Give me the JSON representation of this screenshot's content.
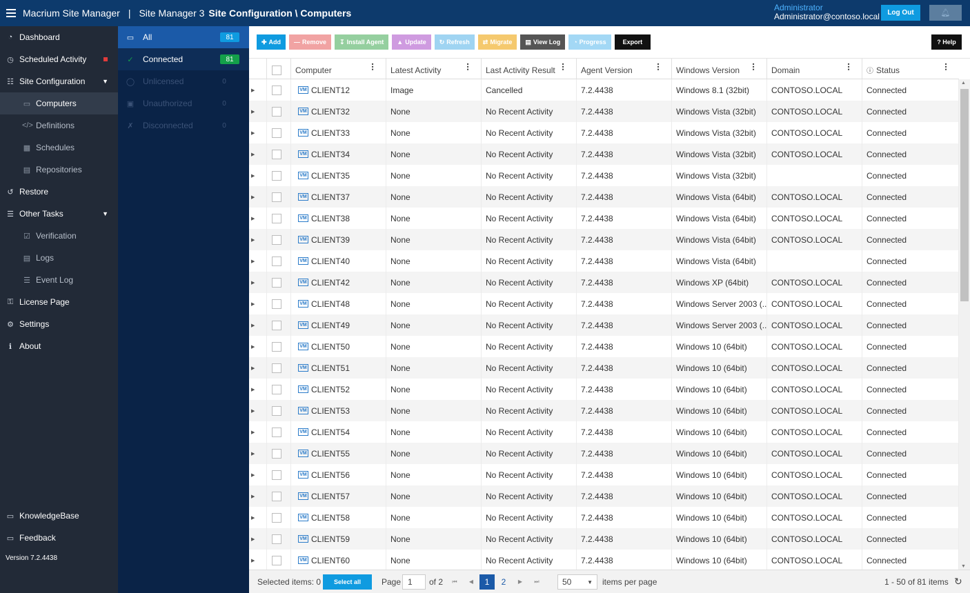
{
  "header": {
    "app_title": "Macrium Site Manager",
    "site": "Site Manager 3",
    "breadcrumb": "Site Configuration \\ Computers",
    "user_role": "Administrator",
    "user_email": "Administrator@contoso.local",
    "logout_label": "Log Out"
  },
  "sidebar": {
    "items": [
      {
        "label": "Dashboard",
        "icon": "dashboard-icon"
      },
      {
        "label": "Scheduled Activity",
        "icon": "clock-icon"
      },
      {
        "label": "Site Configuration",
        "icon": "sitemap-icon"
      },
      {
        "label": "Computers",
        "icon": "monitor-icon"
      },
      {
        "label": "Definitions",
        "icon": "code-icon"
      },
      {
        "label": "Schedules",
        "icon": "calendar-icon"
      },
      {
        "label": "Repositories",
        "icon": "database-icon"
      },
      {
        "label": "Restore",
        "icon": "restore-icon"
      },
      {
        "label": "Other Tasks",
        "icon": "tasks-icon"
      },
      {
        "label": "Verification",
        "icon": "check-square-icon"
      },
      {
        "label": "Logs",
        "icon": "file-icon"
      },
      {
        "label": "Event Log",
        "icon": "list-icon"
      },
      {
        "label": "License Page",
        "icon": "key-icon"
      },
      {
        "label": "Settings",
        "icon": "gear-icon"
      },
      {
        "label": "About",
        "icon": "info-icon"
      }
    ],
    "knowledgebase": "KnowledgeBase",
    "feedback": "Feedback",
    "version": "Version 7.2.4438"
  },
  "filters": [
    {
      "label": "All",
      "count": "81"
    },
    {
      "label": "Connected",
      "count": "81"
    },
    {
      "label": "Unlicensed",
      "count": "0"
    },
    {
      "label": "Unauthorized",
      "count": "0"
    },
    {
      "label": "Disconnected",
      "count": "0"
    }
  ],
  "toolbar": {
    "add": "Add",
    "remove": "Remove",
    "install_agent": "Install Agent",
    "update": "Update",
    "refresh": "Refresh",
    "migrate": "Migrate",
    "view_log": "View Log",
    "progress": "Progress",
    "export": "Export",
    "help": "Help"
  },
  "colors": {
    "topbar": "#0d3a6c",
    "sidebar": "#222a37",
    "filter_panel": "#0a2347",
    "accent": "#0f9be0",
    "connected_badge": "#14a04a"
  },
  "grid": {
    "columns": [
      "Computer",
      "Latest Activity",
      "Last Activity Result",
      "Agent Version",
      "Windows Version",
      "Domain",
      "Status"
    ],
    "rows": [
      [
        "CLIENT12",
        "Image",
        "Cancelled",
        "7.2.4438",
        "Windows 8.1 (32bit)",
        "CONTOSO.LOCAL",
        "Connected"
      ],
      [
        "CLIENT32",
        "None",
        "No Recent Activity",
        "7.2.4438",
        "Windows Vista (32bit)",
        "CONTOSO.LOCAL",
        "Connected"
      ],
      [
        "CLIENT33",
        "None",
        "No Recent Activity",
        "7.2.4438",
        "Windows Vista (32bit)",
        "CONTOSO.LOCAL",
        "Connected"
      ],
      [
        "CLIENT34",
        "None",
        "No Recent Activity",
        "7.2.4438",
        "Windows Vista (32bit)",
        "CONTOSO.LOCAL",
        "Connected"
      ],
      [
        "CLIENT35",
        "None",
        "No Recent Activity",
        "7.2.4438",
        "Windows Vista (32bit)",
        "",
        "Connected"
      ],
      [
        "CLIENT37",
        "None",
        "No Recent Activity",
        "7.2.4438",
        "Windows Vista (64bit)",
        "CONTOSO.LOCAL",
        "Connected"
      ],
      [
        "CLIENT38",
        "None",
        "No Recent Activity",
        "7.2.4438",
        "Windows Vista (64bit)",
        "CONTOSO.LOCAL",
        "Connected"
      ],
      [
        "CLIENT39",
        "None",
        "No Recent Activity",
        "7.2.4438",
        "Windows Vista (64bit)",
        "CONTOSO.LOCAL",
        "Connected"
      ],
      [
        "CLIENT40",
        "None",
        "No Recent Activity",
        "7.2.4438",
        "Windows Vista (64bit)",
        "",
        "Connected"
      ],
      [
        "CLIENT42",
        "None",
        "No Recent Activity",
        "7.2.4438",
        "Windows XP (64bit)",
        "CONTOSO.LOCAL",
        "Connected"
      ],
      [
        "CLIENT48",
        "None",
        "No Recent Activity",
        "7.2.4438",
        "Windows Server 2003 (...",
        "CONTOSO.LOCAL",
        "Connected"
      ],
      [
        "CLIENT49",
        "None",
        "No Recent Activity",
        "7.2.4438",
        "Windows Server 2003 (...",
        "CONTOSO.LOCAL",
        "Connected"
      ],
      [
        "CLIENT50",
        "None",
        "No Recent Activity",
        "7.2.4438",
        "Windows 10 (64bit)",
        "CONTOSO.LOCAL",
        "Connected"
      ],
      [
        "CLIENT51",
        "None",
        "No Recent Activity",
        "7.2.4438",
        "Windows 10 (64bit)",
        "CONTOSO.LOCAL",
        "Connected"
      ],
      [
        "CLIENT52",
        "None",
        "No Recent Activity",
        "7.2.4438",
        "Windows 10 (64bit)",
        "CONTOSO.LOCAL",
        "Connected"
      ],
      [
        "CLIENT53",
        "None",
        "No Recent Activity",
        "7.2.4438",
        "Windows 10 (64bit)",
        "CONTOSO.LOCAL",
        "Connected"
      ],
      [
        "CLIENT54",
        "None",
        "No Recent Activity",
        "7.2.4438",
        "Windows 10 (64bit)",
        "CONTOSO.LOCAL",
        "Connected"
      ],
      [
        "CLIENT55",
        "None",
        "No Recent Activity",
        "7.2.4438",
        "Windows 10 (64bit)",
        "CONTOSO.LOCAL",
        "Connected"
      ],
      [
        "CLIENT56",
        "None",
        "No Recent Activity",
        "7.2.4438",
        "Windows 10 (64bit)",
        "CONTOSO.LOCAL",
        "Connected"
      ],
      [
        "CLIENT57",
        "None",
        "No Recent Activity",
        "7.2.4438",
        "Windows 10 (64bit)",
        "CONTOSO.LOCAL",
        "Connected"
      ],
      [
        "CLIENT58",
        "None",
        "No Recent Activity",
        "7.2.4438",
        "Windows 10 (64bit)",
        "CONTOSO.LOCAL",
        "Connected"
      ],
      [
        "CLIENT59",
        "None",
        "No Recent Activity",
        "7.2.4438",
        "Windows 10 (64bit)",
        "CONTOSO.LOCAL",
        "Connected"
      ],
      [
        "CLIENT60",
        "None",
        "No Recent Activity",
        "7.2.4438",
        "Windows 10 (64bit)",
        "CONTOSO.LOCAL",
        "Connected"
      ]
    ]
  },
  "footer": {
    "selected_items": "Selected items: 0",
    "select_all": "Select all",
    "page_label": "Page",
    "page_value": "1",
    "of_label": "of 2",
    "pages": [
      "1",
      "2"
    ],
    "items_per_page_value": "50",
    "items_per_page_label": "items per page",
    "range": "1 - 50 of 81 items"
  }
}
